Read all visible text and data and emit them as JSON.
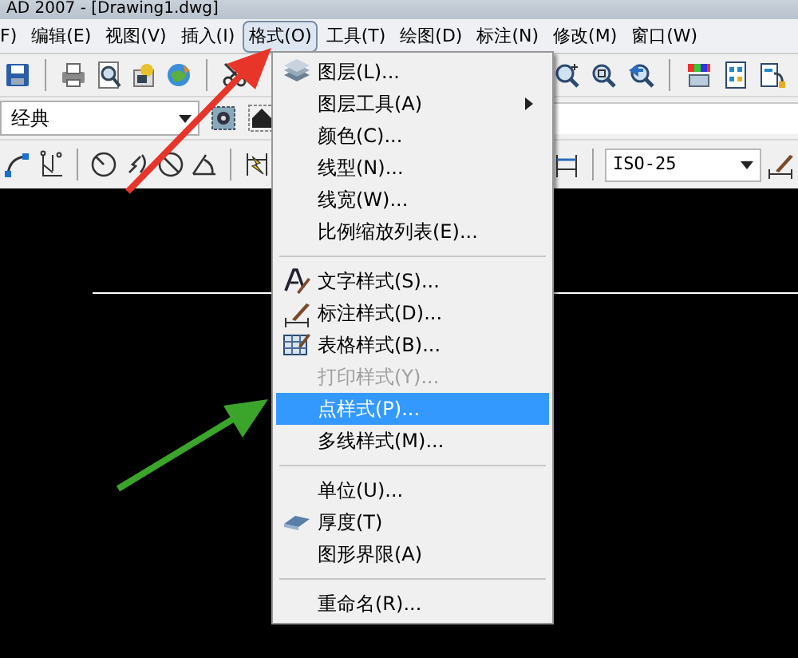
{
  "title_bar": {
    "title": "AD 2007 - [Drawing1.dwg]"
  },
  "menu_bar": [
    {
      "label": "F)",
      "selected": false
    },
    {
      "label": "编辑(E)",
      "selected": false
    },
    {
      "label": "视图(V)",
      "selected": false
    },
    {
      "label": "插入(I)",
      "selected": false
    },
    {
      "label": "格式(O)",
      "selected": true
    },
    {
      "label": "工具(T)",
      "selected": false
    },
    {
      "label": "绘图(D)",
      "selected": false
    },
    {
      "label": "标注(N)",
      "selected": false
    },
    {
      "label": "修改(M)",
      "selected": false
    },
    {
      "label": "窗口(W)",
      "selected": false
    }
  ],
  "workspace_dropdown": {
    "value": "经典"
  },
  "dimstyle_dropdown": {
    "value": "ISO-25"
  },
  "format_menu": [
    {
      "kind": "item",
      "label": "图层(L)...",
      "submenu": false,
      "disabled": false,
      "selected": false
    },
    {
      "kind": "item",
      "label": "图层工具(A)",
      "submenu": true,
      "disabled": false,
      "selected": false
    },
    {
      "kind": "item",
      "label": "颜色(C)...",
      "submenu": false,
      "disabled": false,
      "selected": false
    },
    {
      "kind": "item",
      "label": "线型(N)...",
      "submenu": false,
      "disabled": false,
      "selected": false
    },
    {
      "kind": "item",
      "label": "线宽(W)...",
      "submenu": false,
      "disabled": false,
      "selected": false
    },
    {
      "kind": "item",
      "label": "比例缩放列表(E)...",
      "submenu": false,
      "disabled": false,
      "selected": false
    },
    {
      "kind": "separator"
    },
    {
      "kind": "item",
      "label": "文字样式(S)...",
      "submenu": false,
      "disabled": false,
      "selected": false
    },
    {
      "kind": "item",
      "label": "标注样式(D)...",
      "submenu": false,
      "disabled": false,
      "selected": false
    },
    {
      "kind": "item",
      "label": "表格样式(B)...",
      "submenu": false,
      "disabled": false,
      "selected": false
    },
    {
      "kind": "item",
      "label": "打印样式(Y)...",
      "submenu": false,
      "disabled": true,
      "selected": false
    },
    {
      "kind": "item",
      "label": "点样式(P)...",
      "submenu": false,
      "disabled": false,
      "selected": true
    },
    {
      "kind": "item",
      "label": "多线样式(M)...",
      "submenu": false,
      "disabled": false,
      "selected": false
    },
    {
      "kind": "separator"
    },
    {
      "kind": "item",
      "label": "单位(U)...",
      "submenu": false,
      "disabled": false,
      "selected": false
    },
    {
      "kind": "item",
      "label": "厚度(T)",
      "submenu": false,
      "disabled": false,
      "selected": false
    },
    {
      "kind": "item",
      "label": "图形界限(A)",
      "submenu": false,
      "disabled": false,
      "selected": false
    },
    {
      "kind": "separator"
    },
    {
      "kind": "item",
      "label": "重命名(R)...",
      "submenu": false,
      "disabled": false,
      "selected": false
    }
  ]
}
